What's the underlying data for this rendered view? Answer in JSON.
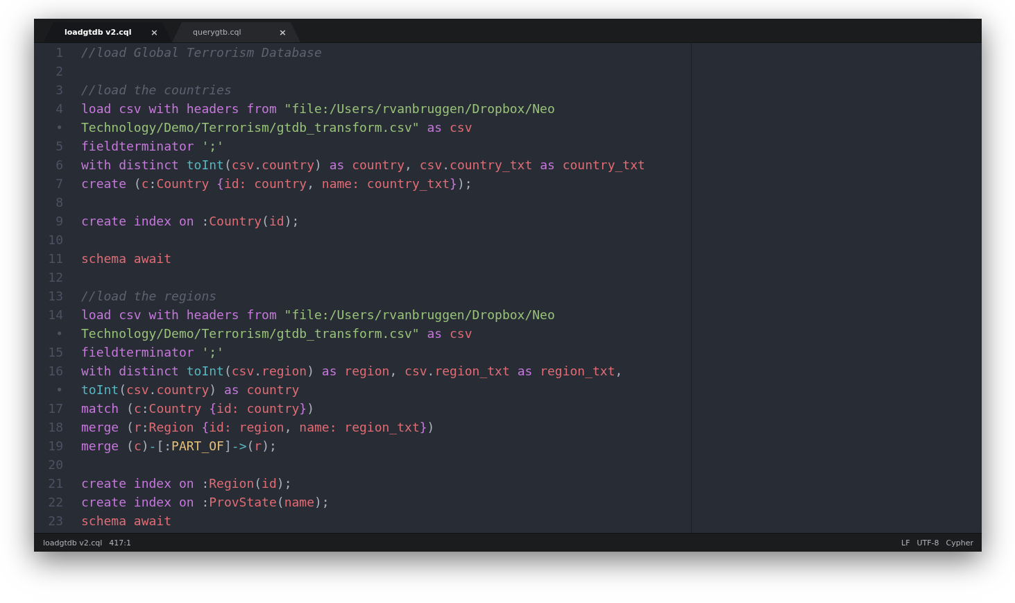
{
  "tabs": [
    {
      "label": "loadgtdb v2.cql",
      "close": "×",
      "selected": true
    },
    {
      "label": "querygtb.cql",
      "close": "×",
      "selected": false
    }
  ],
  "editor": {
    "lines": [
      {
        "number": "1",
        "tokens": [
          {
            "kind": "comment",
            "text": "//load Global Terrorism Database"
          }
        ]
      },
      {
        "number": "2"
      },
      {
        "number": "3",
        "tokens": [
          {
            "kind": "comment",
            "text": "//load the countries"
          }
        ]
      },
      {
        "number": "4",
        "tokens": [
          {
            "kind": "keyword",
            "text": "load csv with headers from "
          },
          {
            "kind": "string",
            "text": "\"file:/Users/rvanbruggen/Dropbox/Neo"
          }
        ]
      },
      {
        "number": "•",
        "tokens": [
          {
            "kind": "string",
            "text": "Technology/Demo/Terrorism/gtdb_transform.csv\""
          },
          {
            "kind": "keyword",
            "text": " as "
          },
          {
            "kind": "variable",
            "text": "csv"
          }
        ]
      },
      {
        "number": "5",
        "tokens": [
          {
            "kind": "keyword",
            "text": "fieldterminator "
          },
          {
            "kind": "string",
            "text": "';'"
          }
        ]
      },
      {
        "number": "6",
        "tokens": [
          {
            "kind": "keyword",
            "text": "with distinct "
          },
          {
            "kind": "function",
            "text": "toInt"
          },
          {
            "kind": "punctuation",
            "text": "("
          },
          {
            "kind": "variable",
            "text": "csv"
          },
          {
            "kind": "punctuation",
            "text": "."
          },
          {
            "kind": "variable",
            "text": "country"
          },
          {
            "kind": "punctuation",
            "text": ")"
          },
          {
            "kind": "keyword",
            "text": " as "
          },
          {
            "kind": "variable",
            "text": "country"
          },
          {
            "kind": "punctuation",
            "text": ", "
          },
          {
            "kind": "variable",
            "text": "csv"
          },
          {
            "kind": "punctuation",
            "text": "."
          },
          {
            "kind": "variable",
            "text": "country_txt"
          },
          {
            "kind": "keyword",
            "text": " as "
          },
          {
            "kind": "variable",
            "text": "country_txt"
          }
        ]
      },
      {
        "number": "7",
        "tokens": [
          {
            "kind": "keyword",
            "text": "create "
          },
          {
            "kind": "punctuation",
            "text": "("
          },
          {
            "kind": "variable",
            "text": "c"
          },
          {
            "kind": "punctuation",
            "text": ":"
          },
          {
            "kind": "variable",
            "text": "Country "
          },
          {
            "kind": "brace",
            "text": "{"
          },
          {
            "kind": "variable",
            "text": "id: country"
          },
          {
            "kind": "punctuation",
            "text": ", "
          },
          {
            "kind": "variable",
            "text": "name: country_txt"
          },
          {
            "kind": "brace",
            "text": "}"
          },
          {
            "kind": "punctuation",
            "text": ");"
          }
        ]
      },
      {
        "number": "8"
      },
      {
        "number": "9",
        "tokens": [
          {
            "kind": "keyword",
            "text": "create index on "
          },
          {
            "kind": "punctuation",
            "text": ":"
          },
          {
            "kind": "variable",
            "text": "Country"
          },
          {
            "kind": "punctuation",
            "text": "("
          },
          {
            "kind": "variable",
            "text": "id"
          },
          {
            "kind": "punctuation",
            "text": ");"
          }
        ]
      },
      {
        "number": "10"
      },
      {
        "number": "11",
        "tokens": [
          {
            "kind": "variable",
            "text": "schema await"
          }
        ]
      },
      {
        "number": "12"
      },
      {
        "number": "13",
        "tokens": [
          {
            "kind": "comment",
            "text": "//load the regions"
          }
        ]
      },
      {
        "number": "14",
        "tokens": [
          {
            "kind": "keyword",
            "text": "load csv with headers from "
          },
          {
            "kind": "string",
            "text": "\"file:/Users/rvanbruggen/Dropbox/Neo"
          }
        ]
      },
      {
        "number": "•",
        "tokens": [
          {
            "kind": "string",
            "text": "Technology/Demo/Terrorism/gtdb_transform.csv\""
          },
          {
            "kind": "keyword",
            "text": " as "
          },
          {
            "kind": "variable",
            "text": "csv"
          }
        ]
      },
      {
        "number": "15",
        "tokens": [
          {
            "kind": "keyword",
            "text": "fieldterminator "
          },
          {
            "kind": "string",
            "text": "';'"
          }
        ]
      },
      {
        "number": "16",
        "tokens": [
          {
            "kind": "keyword",
            "text": "with distinct "
          },
          {
            "kind": "function",
            "text": "toInt"
          },
          {
            "kind": "punctuation",
            "text": "("
          },
          {
            "kind": "variable",
            "text": "csv"
          },
          {
            "kind": "punctuation",
            "text": "."
          },
          {
            "kind": "variable",
            "text": "region"
          },
          {
            "kind": "punctuation",
            "text": ")"
          },
          {
            "kind": "keyword",
            "text": " as "
          },
          {
            "kind": "variable",
            "text": "region"
          },
          {
            "kind": "punctuation",
            "text": ", "
          },
          {
            "kind": "variable",
            "text": "csv"
          },
          {
            "kind": "punctuation",
            "text": "."
          },
          {
            "kind": "variable",
            "text": "region_txt"
          },
          {
            "kind": "keyword",
            "text": " as "
          },
          {
            "kind": "variable",
            "text": "region_txt"
          },
          {
            "kind": "punctuation",
            "text": ","
          }
        ]
      },
      {
        "number": "•",
        "tokens": [
          {
            "kind": "function",
            "text": "toInt"
          },
          {
            "kind": "punctuation",
            "text": "("
          },
          {
            "kind": "variable",
            "text": "csv"
          },
          {
            "kind": "punctuation",
            "text": "."
          },
          {
            "kind": "variable",
            "text": "country"
          },
          {
            "kind": "punctuation",
            "text": ")"
          },
          {
            "kind": "keyword",
            "text": " as "
          },
          {
            "kind": "variable",
            "text": "country"
          }
        ]
      },
      {
        "number": "17",
        "tokens": [
          {
            "kind": "keyword",
            "text": "match "
          },
          {
            "kind": "punctuation",
            "text": "("
          },
          {
            "kind": "variable",
            "text": "c"
          },
          {
            "kind": "punctuation",
            "text": ":"
          },
          {
            "kind": "variable",
            "text": "Country "
          },
          {
            "kind": "brace",
            "text": "{"
          },
          {
            "kind": "variable",
            "text": "id: country"
          },
          {
            "kind": "brace",
            "text": "}"
          },
          {
            "kind": "punctuation",
            "text": ")"
          }
        ]
      },
      {
        "number": "18",
        "tokens": [
          {
            "kind": "keyword",
            "text": "merge "
          },
          {
            "kind": "punctuation",
            "text": "("
          },
          {
            "kind": "variable",
            "text": "r"
          },
          {
            "kind": "punctuation",
            "text": ":"
          },
          {
            "kind": "variable",
            "text": "Region "
          },
          {
            "kind": "brace",
            "text": "{"
          },
          {
            "kind": "variable",
            "text": "id: region"
          },
          {
            "kind": "punctuation",
            "text": ", "
          },
          {
            "kind": "variable",
            "text": "name: region_txt"
          },
          {
            "kind": "brace",
            "text": "}"
          },
          {
            "kind": "punctuation",
            "text": ")"
          }
        ]
      },
      {
        "number": "19",
        "tokens": [
          {
            "kind": "keyword",
            "text": "merge "
          },
          {
            "kind": "punctuation",
            "text": "("
          },
          {
            "kind": "variable",
            "text": "c"
          },
          {
            "kind": "punctuation",
            "text": ")"
          },
          {
            "kind": "function",
            "text": "-"
          },
          {
            "kind": "punctuation",
            "text": "[:"
          },
          {
            "kind": "label",
            "text": "PART_OF"
          },
          {
            "kind": "punctuation",
            "text": "]"
          },
          {
            "kind": "function",
            "text": "->"
          },
          {
            "kind": "punctuation",
            "text": "("
          },
          {
            "kind": "variable",
            "text": "r"
          },
          {
            "kind": "punctuation",
            "text": ");"
          }
        ]
      },
      {
        "number": "20"
      },
      {
        "number": "21",
        "tokens": [
          {
            "kind": "keyword",
            "text": "create index on "
          },
          {
            "kind": "punctuation",
            "text": ":"
          },
          {
            "kind": "variable",
            "text": "Region"
          },
          {
            "kind": "punctuation",
            "text": "("
          },
          {
            "kind": "variable",
            "text": "id"
          },
          {
            "kind": "punctuation",
            "text": ");"
          }
        ]
      },
      {
        "number": "22",
        "tokens": [
          {
            "kind": "keyword",
            "text": "create index on "
          },
          {
            "kind": "punctuation",
            "text": ":"
          },
          {
            "kind": "variable",
            "text": "ProvState"
          },
          {
            "kind": "punctuation",
            "text": "("
          },
          {
            "kind": "variable",
            "text": "name"
          },
          {
            "kind": "punctuation",
            "text": ");"
          }
        ]
      },
      {
        "number": "23",
        "tokens": [
          {
            "kind": "variable",
            "text": "schema await"
          }
        ]
      }
    ]
  },
  "status_bar": {
    "file": "loadgtdb v2.cql",
    "position": "417:1",
    "line_ending": "LF",
    "encoding": "UTF-8",
    "syntax": "Cypher"
  }
}
